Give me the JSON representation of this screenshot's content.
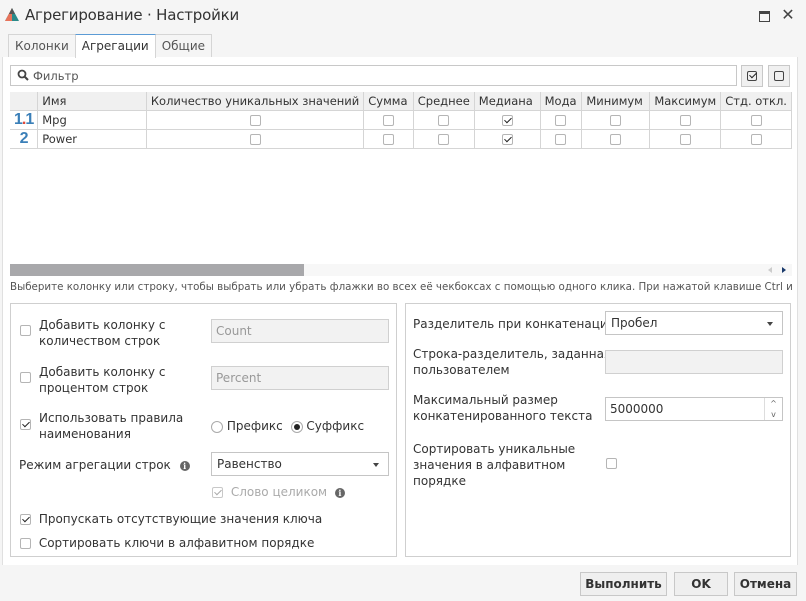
{
  "window": {
    "title": "Агрегирование · Настройки",
    "icons": {
      "app": "app-logo-triangle-icon",
      "maximize": "maximize-icon",
      "close": "close-icon"
    }
  },
  "tabs": [
    {
      "label": "Колонки",
      "active": false
    },
    {
      "label": "Агрегации",
      "active": true
    },
    {
      "label": "Общие",
      "active": false
    }
  ],
  "filter": {
    "placeholder": "Фильтр",
    "value": "",
    "icon": "search-icon",
    "check_all_icon": "check-all-icon",
    "uncheck_all_icon": "uncheck-all-icon"
  },
  "grid": {
    "columns": [
      "",
      "Имя",
      "Количество уникальных значений",
      "Сумма",
      "Среднее",
      "Медиана",
      "Мода",
      "Минимум",
      "Максимум",
      "Стд. откл."
    ],
    "rows": [
      {
        "type_icon": "1.1",
        "type_name": "decimal-type-icon",
        "name": "Mpg",
        "checks": [
          false,
          false,
          false,
          true,
          false,
          false,
          false,
          false
        ]
      },
      {
        "type_icon": "2",
        "type_name": "integer-type-icon",
        "name": "Power",
        "checks": [
          false,
          false,
          false,
          true,
          false,
          false,
          false,
          false
        ]
      }
    ],
    "scroll_position_fraction": 0.0
  },
  "hint": "Выберите колонку или строку, чтобы выбрать или убрать флажки во всех её чекбоксах с помощью одного клика. При нажатой клавише Ctrl инверти...",
  "left_options": {
    "add_count": {
      "label": "Добавить колонку с количеством строк",
      "line1": "Добавить колонку с",
      "line2": "количеством строк",
      "checked": false,
      "field_value": "Count"
    },
    "add_percent": {
      "label": "Добавить колонку с процентом строк",
      "line1": "Добавить колонку с",
      "line2": "процентом строк",
      "checked": false,
      "field_value": "Percent"
    },
    "naming_rules": {
      "line1": "Использовать правила",
      "line2": "наименования",
      "checked": true,
      "prefix_label": "Префикс",
      "suffix_label": "Суффикс",
      "selected": "suffix"
    },
    "aggregation_mode": {
      "label": "Режим агрегации строк",
      "value": "Равенство"
    },
    "whole_word": {
      "label": "Слово целиком",
      "checked": true,
      "disabled": true
    },
    "skip_missing": {
      "label": "Пропускать отсутствующие значения ключа",
      "checked": true
    },
    "sort_keys": {
      "label": "Сортировать ключи в алфавитном порядке",
      "checked": false
    }
  },
  "right_options": {
    "concat_separator": {
      "label": "Разделитель при конкатенации",
      "value": "Пробел"
    },
    "custom_separator": {
      "line1": "Строка-разделитель, заданная",
      "line2": "пользователем",
      "value": ""
    },
    "max_size": {
      "line1": "Максимальный размер",
      "line2": "конкатенированного текста",
      "value": "5000000"
    },
    "sort_unique": {
      "line1": "Сортировать уникальные",
      "line2": "значения в алфавитном",
      "line3": "порядке",
      "checked": false
    }
  },
  "footer": {
    "execute": "Выполнить",
    "ok": "OK",
    "cancel": "Отмена"
  }
}
